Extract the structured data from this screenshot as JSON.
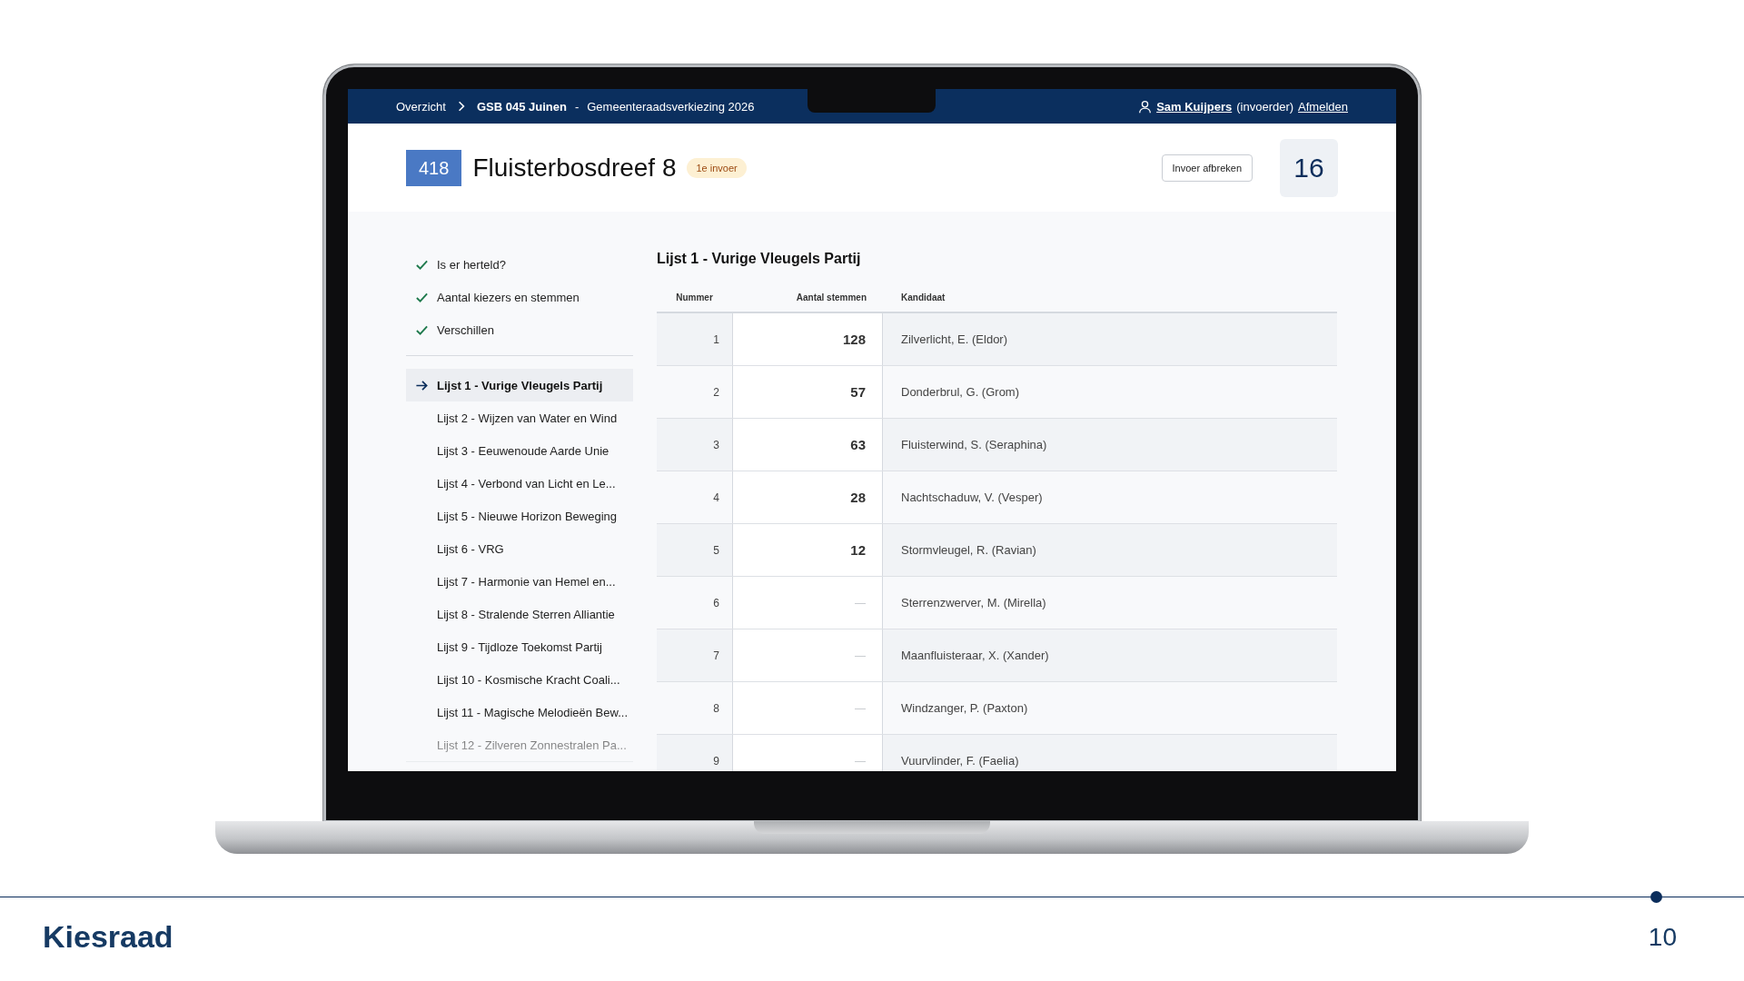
{
  "nav": {
    "breadcrumb": [
      {
        "label": "Overzicht",
        "kind": "link"
      },
      {
        "label": "GSB 045 Juinen",
        "kind": "current"
      }
    ],
    "separator": "-",
    "election": "Gemeenteraadsverkiezing 2026",
    "user": {
      "name": "Sam Kuijpers",
      "role": "(invoerder)"
    },
    "logout": "Afmelden"
  },
  "header": {
    "number": "418",
    "title": "Fluisterbosdreef 8",
    "badge": "1e invoer",
    "abort_button": "Invoer afbreken",
    "counter": "16"
  },
  "sidebar": {
    "steps": [
      {
        "label": "Is er herteld?",
        "done": true
      },
      {
        "label": "Aantal kiezers en stemmen",
        "done": true
      },
      {
        "label": "Verschillen",
        "done": true
      }
    ],
    "lists": [
      {
        "label": "Lijst 1 - Vurige Vleugels Partij",
        "selected": true
      },
      {
        "label": "Lijst 2 - Wijzen van Water en Wind",
        "selected": false
      },
      {
        "label": "Lijst 3 - Eeuwenoude Aarde Unie",
        "selected": false
      },
      {
        "label": "Lijst 4 - Verbond van Licht en Le...",
        "selected": false
      },
      {
        "label": "Lijst 5 - Nieuwe Horizon Beweging",
        "selected": false
      },
      {
        "label": "Lijst 6 - VRG",
        "selected": false
      },
      {
        "label": "Lijst 7 - Harmonie van Hemel en...",
        "selected": false
      },
      {
        "label": "Lijst 8 - Stralende Sterren Alliantie",
        "selected": false
      },
      {
        "label": "Lijst 9 - Tijdloze Toekomst Partij",
        "selected": false
      },
      {
        "label": "Lijst 10 - Kosmische Kracht Coali...",
        "selected": false
      },
      {
        "label": "Lijst 11 - Magische Melodieën Bew...",
        "selected": false
      },
      {
        "label": "Lijst 12 - Zilveren Zonnestralen Pa...",
        "selected": false
      }
    ]
  },
  "section": {
    "title": "Lijst 1 - Vurige Vleugels Partij",
    "table": {
      "columns": [
        "Nummer",
        "Aantal stemmen",
        "Kandidaat"
      ],
      "rows": [
        {
          "number": "1",
          "votes": "128",
          "candidate": "Zilverlicht, E. (Eldor)"
        },
        {
          "number": "2",
          "votes": "57",
          "candidate": "Donderbrul, G. (Grom)"
        },
        {
          "number": "3",
          "votes": "63",
          "candidate": "Fluisterwind, S. (Seraphina)"
        },
        {
          "number": "4",
          "votes": "28",
          "candidate": "Nachtschaduw, V. (Vesper)"
        },
        {
          "number": "5",
          "votes": "12",
          "candidate": "Stormvleugel, R. (Ravian)"
        },
        {
          "number": "6",
          "placeholder": "—",
          "candidate": "Sterrenzwerver, M. (Mirella)"
        },
        {
          "number": "7",
          "placeholder": "—",
          "candidate": "Maanfluisteraar, X. (Xander)"
        },
        {
          "number": "8",
          "placeholder": "—",
          "candidate": "Windzanger, P. (Paxton)"
        },
        {
          "number": "9",
          "placeholder": "—",
          "candidate": "Vuurvlinder, F. (Faelia)"
        }
      ]
    }
  },
  "footer": {
    "logo": "Kiesraad",
    "page": "10"
  }
}
